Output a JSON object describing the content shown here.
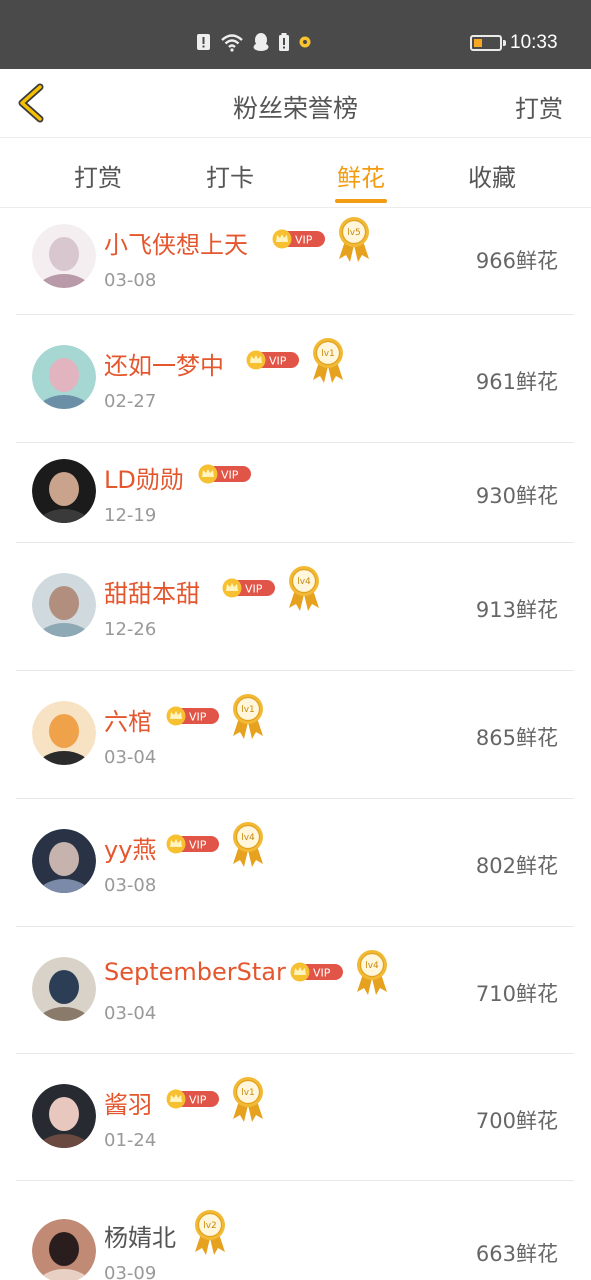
{
  "status_bar": {
    "time": "10:33"
  },
  "nav": {
    "title": "粉丝荣誉榜",
    "action": "打赏"
  },
  "tabs": [
    {
      "label": "打赏"
    },
    {
      "label": "打卡"
    },
    {
      "label": "鲜花"
    },
    {
      "label": "收藏"
    }
  ],
  "active_tab": 2,
  "vip_label": "VIP",
  "rows": [
    {
      "name": "小飞侠想上天",
      "date": "03-08",
      "count": "966鲜花",
      "vip": true,
      "level": "lv5"
    },
    {
      "name": "还如一梦中",
      "date": "02-27",
      "count": "961鲜花",
      "vip": true,
      "level": "lv1"
    },
    {
      "name": "LD勋勋",
      "date": "12-19",
      "count": "930鲜花",
      "vip": true,
      "level": ""
    },
    {
      "name": "甜甜本甜",
      "date": "12-26",
      "count": "913鲜花",
      "vip": true,
      "level": "lv4"
    },
    {
      "name": "六棺",
      "date": "03-04",
      "count": "865鲜花",
      "vip": true,
      "level": "lv1"
    },
    {
      "name": "yy燕",
      "date": "03-08",
      "count": "802鲜花",
      "vip": true,
      "level": "lv4"
    },
    {
      "name": "SeptemberStar",
      "date": "03-04",
      "count": "710鲜花",
      "vip": true,
      "level": "lv4"
    },
    {
      "name": "酱羽",
      "date": "01-24",
      "count": "700鲜花",
      "vip": true,
      "level": "lv1"
    },
    {
      "name": "杨婧北",
      "date": "03-09",
      "count": "663鲜花",
      "vip": false,
      "level": "lv2"
    }
  ],
  "colors": {
    "accent": "#f39c12",
    "name_vip": "#e4572e",
    "status_bar": "#4a4a4a"
  }
}
